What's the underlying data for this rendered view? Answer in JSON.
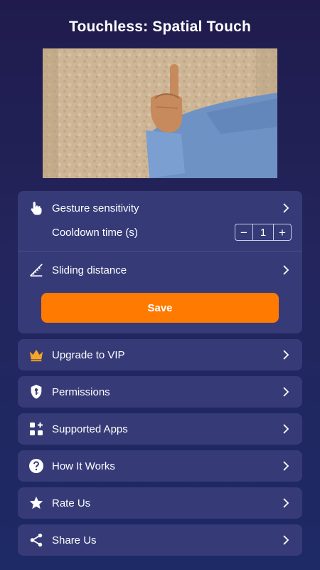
{
  "app": {
    "title": "Touchless: Spatial Touch"
  },
  "settings": {
    "gesture_sensitivity": "Gesture sensitivity",
    "cooldown_time": "Cooldown time (s)",
    "cooldown_value": "1",
    "decrement": "−",
    "increment": "+",
    "sliding_distance": "Sliding distance",
    "save": "Save"
  },
  "menu": [
    {
      "label": "Upgrade to VIP",
      "icon": "crown-icon"
    },
    {
      "label": "Permissions",
      "icon": "shield-key-icon"
    },
    {
      "label": "Supported Apps",
      "icon": "apps-grid-icon"
    },
    {
      "label": "How It Works",
      "icon": "help-icon"
    },
    {
      "label": "Rate Us",
      "icon": "star-icon"
    },
    {
      "label": "Share Us",
      "icon": "share-icon"
    }
  ],
  "colors": {
    "background": "#1f1b4d",
    "card": "#363b78",
    "accent": "#ff7a00",
    "crown": "#f6a623"
  }
}
